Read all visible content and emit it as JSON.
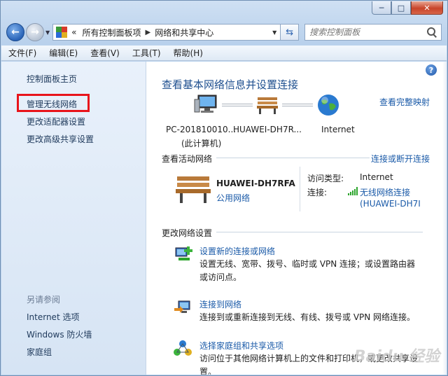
{
  "window": {
    "caption_min": "─",
    "caption_max": "□",
    "caption_close": "✕"
  },
  "address": {
    "overflow": "«",
    "crumb1": "所有控制面板项",
    "crumb2": "网络和共享中心",
    "search_placeholder": "搜索控制面板"
  },
  "menu": [
    "文件(F)",
    "编辑(E)",
    "查看(V)",
    "工具(T)",
    "帮助(H)"
  ],
  "sidebar": {
    "home": "控制面板主页",
    "items": [
      "管理无线网络",
      "更改适配器设置",
      "更改高级共享设置"
    ],
    "see_also_title": "另请参阅",
    "see_also": [
      "Internet 选项",
      "Windows 防火墙",
      "家庭组"
    ]
  },
  "main": {
    "title": "查看基本网络信息并设置连接",
    "full_map_link": "查看完整映射",
    "node_pc": "PC-201810010...",
    "node_pc_sub": "(此计算机)",
    "node_router": "HUAWEI-DH7R...",
    "node_internet": "Internet",
    "active_title": "查看活动网络",
    "connect_link": "连接或断开连接",
    "network_name": "HUAWEI-DH7RFA",
    "network_type": "公用网络",
    "access_label": "访问类型:",
    "access_value": "Internet",
    "conn_label": "连接:",
    "conn_value": "无线网络连接",
    "conn_value2": "(HUAWEI-DH7I",
    "change_title": "更改网络设置",
    "tasks": [
      {
        "link": "设置新的连接或网络",
        "desc": "设置无线、宽带、拨号、临时或 VPN 连接；或设置路由器或访问点。"
      },
      {
        "link": "连接到网络",
        "desc": "连接到或重新连接到无线、有线、拨号或 VPN 网络连接。"
      },
      {
        "link": "选择家庭组和共享选项",
        "desc": "访问位于其他网络计算机上的文件和打印机，或更改共享设置。"
      }
    ],
    "watermark": "Baidu 经验"
  },
  "colors": {
    "highlight": "#e8141b",
    "link": "#1a5aa8",
    "title": "#1e4f8f"
  }
}
